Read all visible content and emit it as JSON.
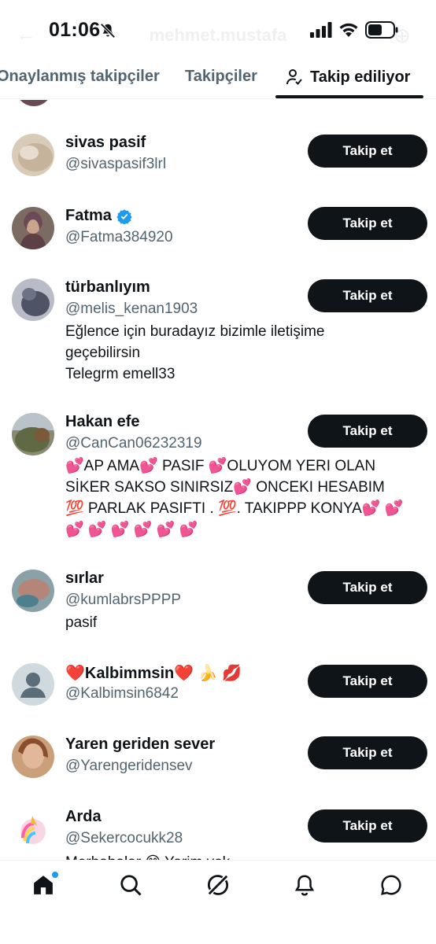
{
  "status_bar": {
    "time": "01:06",
    "background_title": "mehmet.mustafa"
  },
  "tabs": [
    {
      "label": "Onaylanmış takipçiler",
      "active": false
    },
    {
      "label": "Takipçiler",
      "active": false
    },
    {
      "label": "Takip ediliyor",
      "active": true
    }
  ],
  "users": [
    {
      "name": "sivas pasif",
      "handle": "@sivaspasif3lrl",
      "bio": [],
      "button": "Takip et",
      "verified": false
    },
    {
      "name": "Fatma",
      "handle": "@Fatma384920",
      "bio": [],
      "button": "Takip et",
      "verified": true
    },
    {
      "name": "türbanlıyım",
      "handle": "@melis_kenan1903",
      "bio": [
        "Eğlence için buradayız bizimle iletişime",
        "geçebilirsin",
        "Telegrm emell33"
      ],
      "button": "Takip et",
      "verified": false
    },
    {
      "name": "Hakan efe",
      "handle": "@CanCan06232319",
      "bio": [
        "💕AP AMA💕  PASIF 💕OLUYOM YERI OLAN",
        "SİKER SAKSO SINIRSIZ💕  ONCEKI HESABIM",
        "💯 PARLAK PASIFTI . 💯. TAKIPPP KONYA💕 💕",
        "💕 💕 💕 💕 💕 💕"
      ],
      "button": "Takip et",
      "verified": false
    },
    {
      "name": "sırlar",
      "handle": "@kumlabrsPPPP",
      "bio": [
        "pasif"
      ],
      "button": "Takip et",
      "verified": false
    },
    {
      "name": "❤️Kalbimmsin❤️ 🍌 💋",
      "handle": "@Kalbimsin6842",
      "bio": [],
      "button": "Takip et",
      "verified": false
    },
    {
      "name": "Yaren geriden sever",
      "handle": "@Yarengeridensev",
      "bio": [],
      "button": "Takip et",
      "verified": false
    },
    {
      "name": "Arda",
      "handle": "@Sekercocukk28",
      "bio": [
        "Merhabalar 😊 Yarim yok"
      ],
      "button": "Takip et",
      "verified": false
    }
  ],
  "bottom_nav": [
    {
      "icon": "home-icon",
      "has_dot": true
    },
    {
      "icon": "search-icon",
      "has_dot": false
    },
    {
      "icon": "grok-icon",
      "has_dot": false
    },
    {
      "icon": "notifications-icon",
      "has_dot": false
    },
    {
      "icon": "messages-icon",
      "has_dot": false
    }
  ],
  "colors": {
    "text": "#0f1419",
    "secondary": "#536471",
    "accent": "#1d9bf0",
    "button_bg": "#0f1419"
  }
}
